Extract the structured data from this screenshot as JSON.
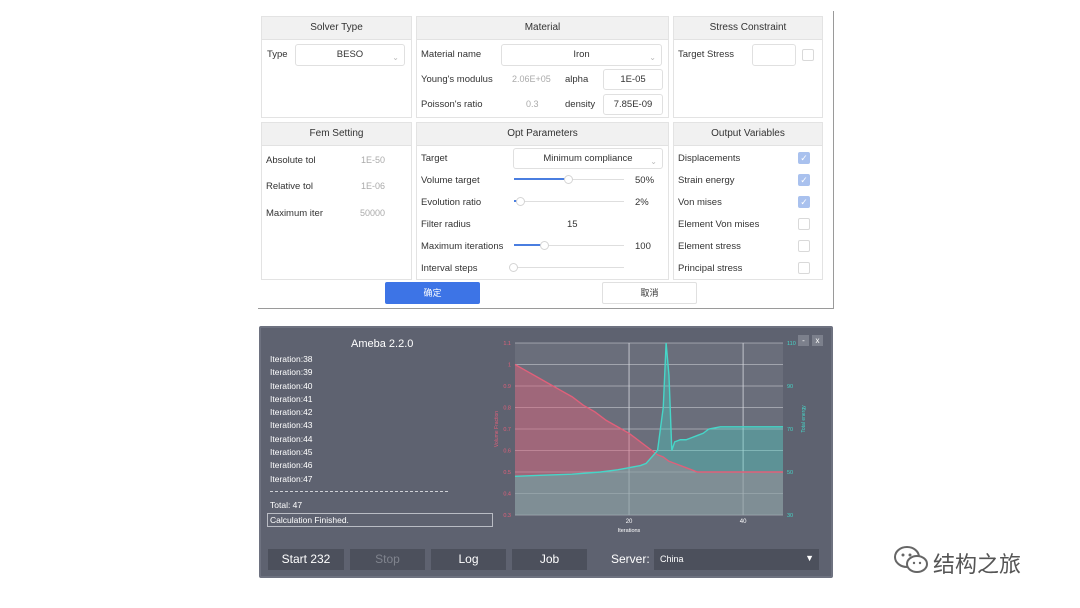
{
  "dialog": {
    "solver": {
      "title": "Solver Type",
      "type_label": "Type",
      "type_value": "BESO"
    },
    "material": {
      "title": "Material",
      "name_label": "Material name",
      "name_value": "Iron",
      "youngs_label": "Young's modulus",
      "youngs_value": "2.06E+05",
      "alpha_label": "alpha",
      "alpha_value": "1E-05",
      "poisson_label": "Poisson's ratio",
      "poisson_value": "0.3",
      "density_label": "density",
      "density_value": "7.85E-09"
    },
    "stress": {
      "title": "Stress Constraint",
      "target_label": "Target Stress",
      "target_value": "",
      "enabled": false
    },
    "fem": {
      "title": "Fem Setting",
      "rows": [
        {
          "label": "Absolute tol",
          "value": "1E-50"
        },
        {
          "label": "Relative tol",
          "value": "1E-06"
        },
        {
          "label": "Maximum iter",
          "value": "50000"
        }
      ]
    },
    "opt": {
      "title": "Opt Parameters",
      "target_label": "Target",
      "target_value": "Minimum compliance",
      "sliders": [
        {
          "label": "Volume target",
          "value": "50%",
          "level": 0.5
        },
        {
          "label": "Evolution ratio",
          "value": "2%",
          "level": 0.06
        },
        {
          "label": "Filter radius",
          "value": "15",
          "level": 0.0
        },
        {
          "label": "Maximum iterations",
          "value": "100",
          "level": 0.28
        },
        {
          "label": "Interval steps",
          "value": "",
          "level": 0.0
        }
      ]
    },
    "output": {
      "title": "Output Variables",
      "items": [
        {
          "label": "Displacements",
          "checked": true
        },
        {
          "label": "Strain energy",
          "checked": true
        },
        {
          "label": "Von mises",
          "checked": true
        },
        {
          "label": "Element Von mises",
          "checked": false
        },
        {
          "label": "Element stress",
          "checked": false
        },
        {
          "label": "Principal stress",
          "checked": false
        }
      ]
    },
    "ok_label": "确定",
    "cancel_label": "取消"
  },
  "ameba": {
    "title": "Ameba 2.2.0",
    "minimize": "-",
    "close": "x",
    "log_lines": [
      "Iteration:38",
      "Iteration:39",
      "Iteration:40",
      "Iteration:41",
      "Iteration:42",
      "Iteration:43",
      "Iteration:44",
      "Iteration:45",
      "Iteration:46",
      "Iteration:47"
    ],
    "separator": "---------------------------------------------------------",
    "total": "Total: 47",
    "status": "Calculation Finished.",
    "buttons": {
      "start": "Start 232",
      "stop": "Stop",
      "log": "Log",
      "job": "Job"
    },
    "server_label": "Server:",
    "server_value": "China"
  },
  "chart_data": {
    "type": "area",
    "xlabel": "Iterations",
    "ylabel_left": "Volume Fraction",
    "ylabel_right": "Total energy",
    "xlim": [
      0,
      47
    ],
    "ylim_left": [
      0.3,
      1.1
    ],
    "ylim_right": [
      30,
      110
    ],
    "x_ticks": [
      20,
      40
    ],
    "y_left_ticks": [
      0.3,
      0.4,
      0.5,
      0.6,
      0.7,
      0.8,
      0.9,
      1.0,
      1.1
    ],
    "y_left_tick_labels": [
      "0.3",
      "0.4",
      "0.5",
      "0.6",
      "0.7",
      "0.8",
      "0.9",
      "1",
      "1.1"
    ],
    "y_right_ticks": [
      30,
      50,
      70,
      90,
      110
    ],
    "grid": true,
    "colors": {
      "volume": "#e0607a",
      "energy": "#46d6c8"
    },
    "series": [
      {
        "axis": "left",
        "x": [
          0,
          2,
          4,
          6,
          8,
          10,
          12,
          14,
          16,
          18,
          20,
          22,
          24,
          25,
          26,
          27,
          28,
          30,
          32,
          34,
          36,
          38,
          40,
          42,
          44,
          46,
          47
        ],
        "values": [
          1.0,
          0.97,
          0.94,
          0.91,
          0.88,
          0.85,
          0.81,
          0.78,
          0.74,
          0.71,
          0.68,
          0.64,
          0.6,
          0.58,
          0.57,
          0.55,
          0.54,
          0.52,
          0.5,
          0.5,
          0.5,
          0.5,
          0.5,
          0.5,
          0.5,
          0.5,
          0.5
        ]
      },
      {
        "axis": "right",
        "x": [
          0,
          5,
          10,
          15,
          18,
          20,
          22,
          23,
          24,
          25,
          26,
          26.5,
          27,
          27.5,
          28,
          29,
          30,
          31,
          32,
          33,
          34,
          36,
          38,
          40,
          42,
          44,
          46,
          47
        ],
        "values": [
          48,
          48.5,
          49,
          50,
          51,
          52,
          53,
          54,
          57,
          60,
          80,
          110,
          95,
          60,
          64,
          65,
          65,
          66,
          67,
          68,
          70,
          71,
          71,
          71,
          71,
          71,
          71,
          71
        ]
      }
    ]
  }
}
